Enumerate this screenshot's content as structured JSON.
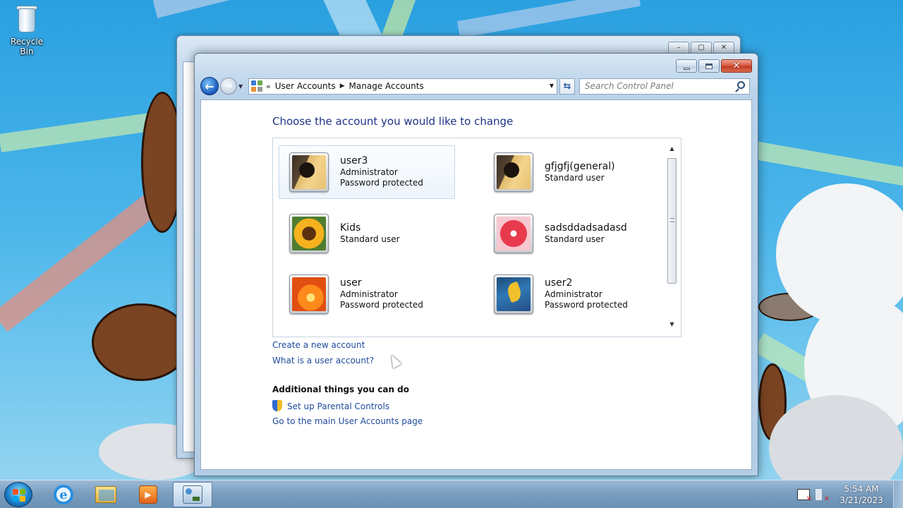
{
  "desktop": {
    "recycle_bin_label": "Recycle Bin"
  },
  "window": {
    "breadcrumb": [
      "User Accounts",
      "Manage Accounts"
    ],
    "search_placeholder": "Search Control Panel",
    "heading": "Choose the account you would like to change",
    "accounts": [
      {
        "name": "user3",
        "type": "Administrator",
        "status": "Password protected",
        "picture": "guitar-picture",
        "selected": true
      },
      {
        "name": "gfjgfj(general)",
        "type": "Standard user",
        "status": "",
        "picture": "guitar-picture",
        "selected": false
      },
      {
        "name": "Kids",
        "type": "Standard user",
        "status": "",
        "picture": "sunflower-picture",
        "selected": false
      },
      {
        "name": "sadsddadsadasd",
        "type": "Standard user",
        "status": "",
        "picture": "starfish-picture",
        "selected": false
      },
      {
        "name": "user",
        "type": "Administrator",
        "status": "Password protected",
        "picture": "orange-flower-picture",
        "selected": false
      },
      {
        "name": "user2",
        "type": "Administrator",
        "status": "Password protected",
        "picture": "leaf-picture",
        "selected": false
      }
    ],
    "links": {
      "create_account": "Create a new account",
      "what_is": "What is a user account?",
      "additional_heading": "Additional things you can do",
      "parental_controls": "Set up Parental Controls",
      "main_page": "Go to the main User Accounts page"
    }
  },
  "taskbar": {
    "items": [
      "start-orb-icon",
      "internet-explorer-icon",
      "file-explorer-icon",
      "media-player-icon",
      "control-panel-icon"
    ],
    "clock_time": "5:54 AM",
    "clock_date": "3/21/2023"
  },
  "colors": {
    "link": "#1e4a9d",
    "heading": "#1e3287",
    "close_button": "#c13a22"
  }
}
